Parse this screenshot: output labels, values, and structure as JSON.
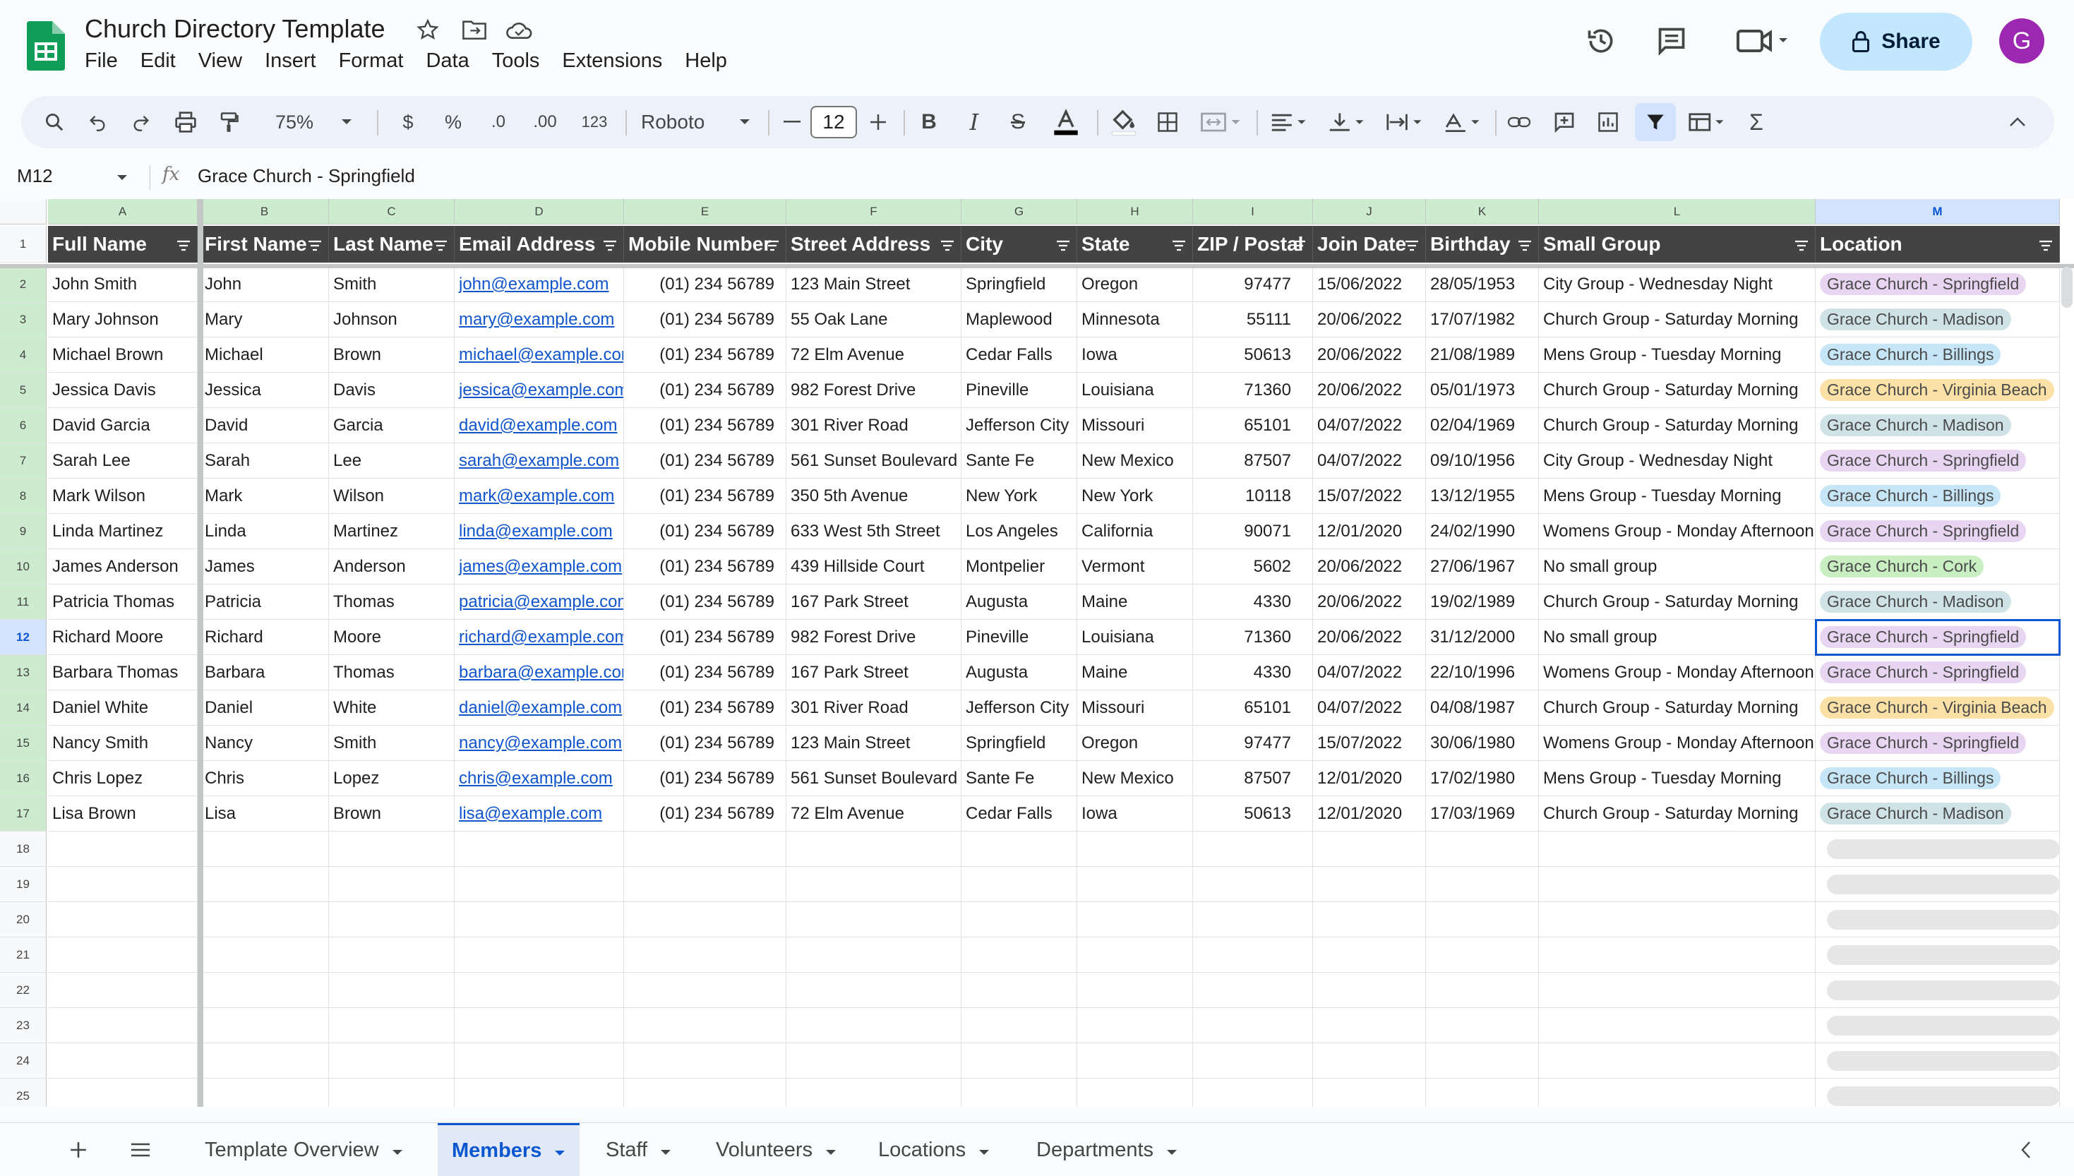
{
  "document": {
    "title": "Church Directory Template"
  },
  "menu": [
    "File",
    "Edit",
    "View",
    "Insert",
    "Format",
    "Data",
    "Tools",
    "Extensions",
    "Help"
  ],
  "header": {
    "share_label": "Share",
    "avatar_initial": "G"
  },
  "toolbar": {
    "zoom": "75%",
    "currency": "$",
    "percent": "%",
    "dec_decrease": ".0",
    "dec_increase": ".00",
    "number_format": "123",
    "font": "Roboto",
    "font_size": "12"
  },
  "formula_bar": {
    "cell_ref": "M12",
    "fx": "fx",
    "value": "Grace Church - Springfield"
  },
  "columns": [
    "A",
    "B",
    "C",
    "D",
    "E",
    "F",
    "G",
    "H",
    "I",
    "J",
    "K",
    "L",
    "M"
  ],
  "headers": [
    "Full Name",
    "First Name",
    "Last Name",
    "Email Address",
    "Mobile Number",
    "Street Address",
    "City",
    "State",
    "ZIP / Postal",
    "Join Date",
    "Birthday",
    "Small Group",
    "Location"
  ],
  "rows": [
    [
      "John Smith",
      "John",
      "Smith",
      "john@example.com",
      "(01) 234 56789",
      "123 Main Street",
      "Springfield",
      "Oregon",
      "97477",
      "15/06/2022",
      "28/05/1953",
      "City Group - Wednesday Night",
      "Grace Church - Springfield"
    ],
    [
      "Mary Johnson",
      "Mary",
      "Johnson",
      "mary@example.com",
      "(01) 234 56789",
      "55 Oak Lane",
      "Maplewood",
      "Minnesota",
      "55111",
      "20/06/2022",
      "17/07/1982",
      "Church Group - Saturday Morning",
      "Grace Church - Madison"
    ],
    [
      "Michael Brown",
      "Michael",
      "Brown",
      "michael@example.com",
      "(01) 234 56789",
      "72 Elm Avenue",
      "Cedar Falls",
      "Iowa",
      "50613",
      "20/06/2022",
      "21/08/1989",
      "Mens Group - Tuesday Morning",
      "Grace Church - Billings"
    ],
    [
      "Jessica Davis",
      "Jessica",
      "Davis",
      "jessica@example.com",
      "(01) 234 56789",
      "982 Forest Drive",
      "Pineville",
      "Louisiana",
      "71360",
      "20/06/2022",
      "05/01/1973",
      "Church Group - Saturday Morning",
      "Grace Church - Virginia Beach"
    ],
    [
      "David Garcia",
      "David",
      "Garcia",
      "david@example.com",
      "(01) 234 56789",
      "301 River Road",
      "Jefferson City",
      "Missouri",
      "65101",
      "04/07/2022",
      "02/04/1969",
      "Church Group - Saturday Morning",
      "Grace Church - Madison"
    ],
    [
      "Sarah Lee",
      "Sarah",
      "Lee",
      "sarah@example.com",
      "(01) 234 56789",
      "561 Sunset Boulevard",
      "Sante Fe",
      "New Mexico",
      "87507",
      "04/07/2022",
      "09/10/1956",
      "City Group - Wednesday Night",
      "Grace Church - Springfield"
    ],
    [
      "Mark Wilson",
      "Mark",
      "Wilson",
      "mark@example.com",
      "(01) 234 56789",
      "350 5th Avenue",
      "New York",
      "New York",
      "10118",
      "15/07/2022",
      "13/12/1955",
      "Mens Group - Tuesday Morning",
      "Grace Church - Billings"
    ],
    [
      "Linda Martinez",
      "Linda",
      "Martinez",
      "linda@example.com",
      "(01) 234 56789",
      "633 West 5th Street",
      "Los Angeles",
      "California",
      "90071",
      "12/01/2020",
      "24/02/1990",
      "Womens Group - Monday Afternoon",
      "Grace Church - Springfield"
    ],
    [
      "James Anderson",
      "James",
      "Anderson",
      "james@example.com",
      "(01) 234 56789",
      "439 Hillside Court",
      "Montpelier",
      "Vermont",
      "5602",
      "20/06/2022",
      "27/06/1967",
      "No small group",
      "Grace Church - Cork"
    ],
    [
      "Patricia Thomas",
      "Patricia",
      "Thomas",
      "patricia@example.com",
      "(01) 234 56789",
      "167 Park Street",
      "Augusta",
      "Maine",
      "4330",
      "20/06/2022",
      "19/02/1989",
      "Church Group - Saturday Morning",
      "Grace Church - Madison"
    ],
    [
      "Richard Moore",
      "Richard",
      "Moore",
      "richard@example.com",
      "(01) 234 56789",
      "982 Forest Drive",
      "Pineville",
      "Louisiana",
      "71360",
      "20/06/2022",
      "31/12/2000",
      "No small group",
      "Grace Church - Springfield"
    ],
    [
      "Barbara Thomas",
      "Barbara",
      "Thomas",
      "barbara@example.com",
      "(01) 234 56789",
      "167 Park Street",
      "Augusta",
      "Maine",
      "4330",
      "04/07/2022",
      "22/10/1996",
      "Womens Group - Monday Afternoon",
      "Grace Church - Springfield"
    ],
    [
      "Daniel White",
      "Daniel",
      "White",
      "daniel@example.com",
      "(01) 234 56789",
      "301 River Road",
      "Jefferson City",
      "Missouri",
      "65101",
      "04/07/2022",
      "04/08/1987",
      "Church Group - Saturday Morning",
      "Grace Church - Virginia Beach"
    ],
    [
      "Nancy Smith",
      "Nancy",
      "Smith",
      "nancy@example.com",
      "(01) 234 56789",
      "123 Main Street",
      "Springfield",
      "Oregon",
      "97477",
      "15/07/2022",
      "30/06/1980",
      "Womens Group - Monday Afternoon",
      "Grace Church - Springfield"
    ],
    [
      "Chris Lopez",
      "Chris",
      "Lopez",
      "chris@example.com",
      "(01) 234 56789",
      "561 Sunset Boulevard",
      "Sante Fe",
      "New Mexico",
      "87507",
      "12/01/2020",
      "17/02/1980",
      "Mens Group - Tuesday Morning",
      "Grace Church - Billings"
    ],
    [
      "Lisa Brown",
      "Lisa",
      "Brown",
      "lisa@example.com",
      "(01) 234 56789",
      "72 Elm Avenue",
      "Cedar Falls",
      "Iowa",
      "50613",
      "12/01/2020",
      "17/03/1969",
      "Church Group - Saturday Morning",
      "Grace Church - Madison"
    ]
  ],
  "row_numbers": [
    "1",
    "2",
    "3",
    "4",
    "5",
    "6",
    "7",
    "8",
    "9",
    "10",
    "11",
    "12",
    "13",
    "14",
    "15",
    "16",
    "17",
    "18",
    "19",
    "20",
    "21",
    "22",
    "23",
    "24",
    "25"
  ],
  "active_row_number": "12",
  "active_column": "M",
  "location_colors": {
    "Grace Church - Springfield": "#e8d5f2",
    "Grace Church - Madison": "#cfe2e6",
    "Grace Church - Billings": "#c6e5f7",
    "Grace Church - Virginia Beach": "#fbe1a6",
    "Grace Church - Cork": "#c8eec2"
  },
  "sheet_tabs": [
    {
      "label": "Template Overview",
      "active": false
    },
    {
      "label": "Members",
      "active": true
    },
    {
      "label": "Staff",
      "active": false
    },
    {
      "label": "Volunteers",
      "active": false
    },
    {
      "label": "Locations",
      "active": false
    },
    {
      "label": "Departments",
      "active": false
    }
  ],
  "colors": {
    "accent": "#0b57d0",
    "header_fill": "#434343",
    "share_bg": "#c2e7ff",
    "avatar_bg": "#9c27b0",
    "logo_green": "#0f9d58"
  }
}
